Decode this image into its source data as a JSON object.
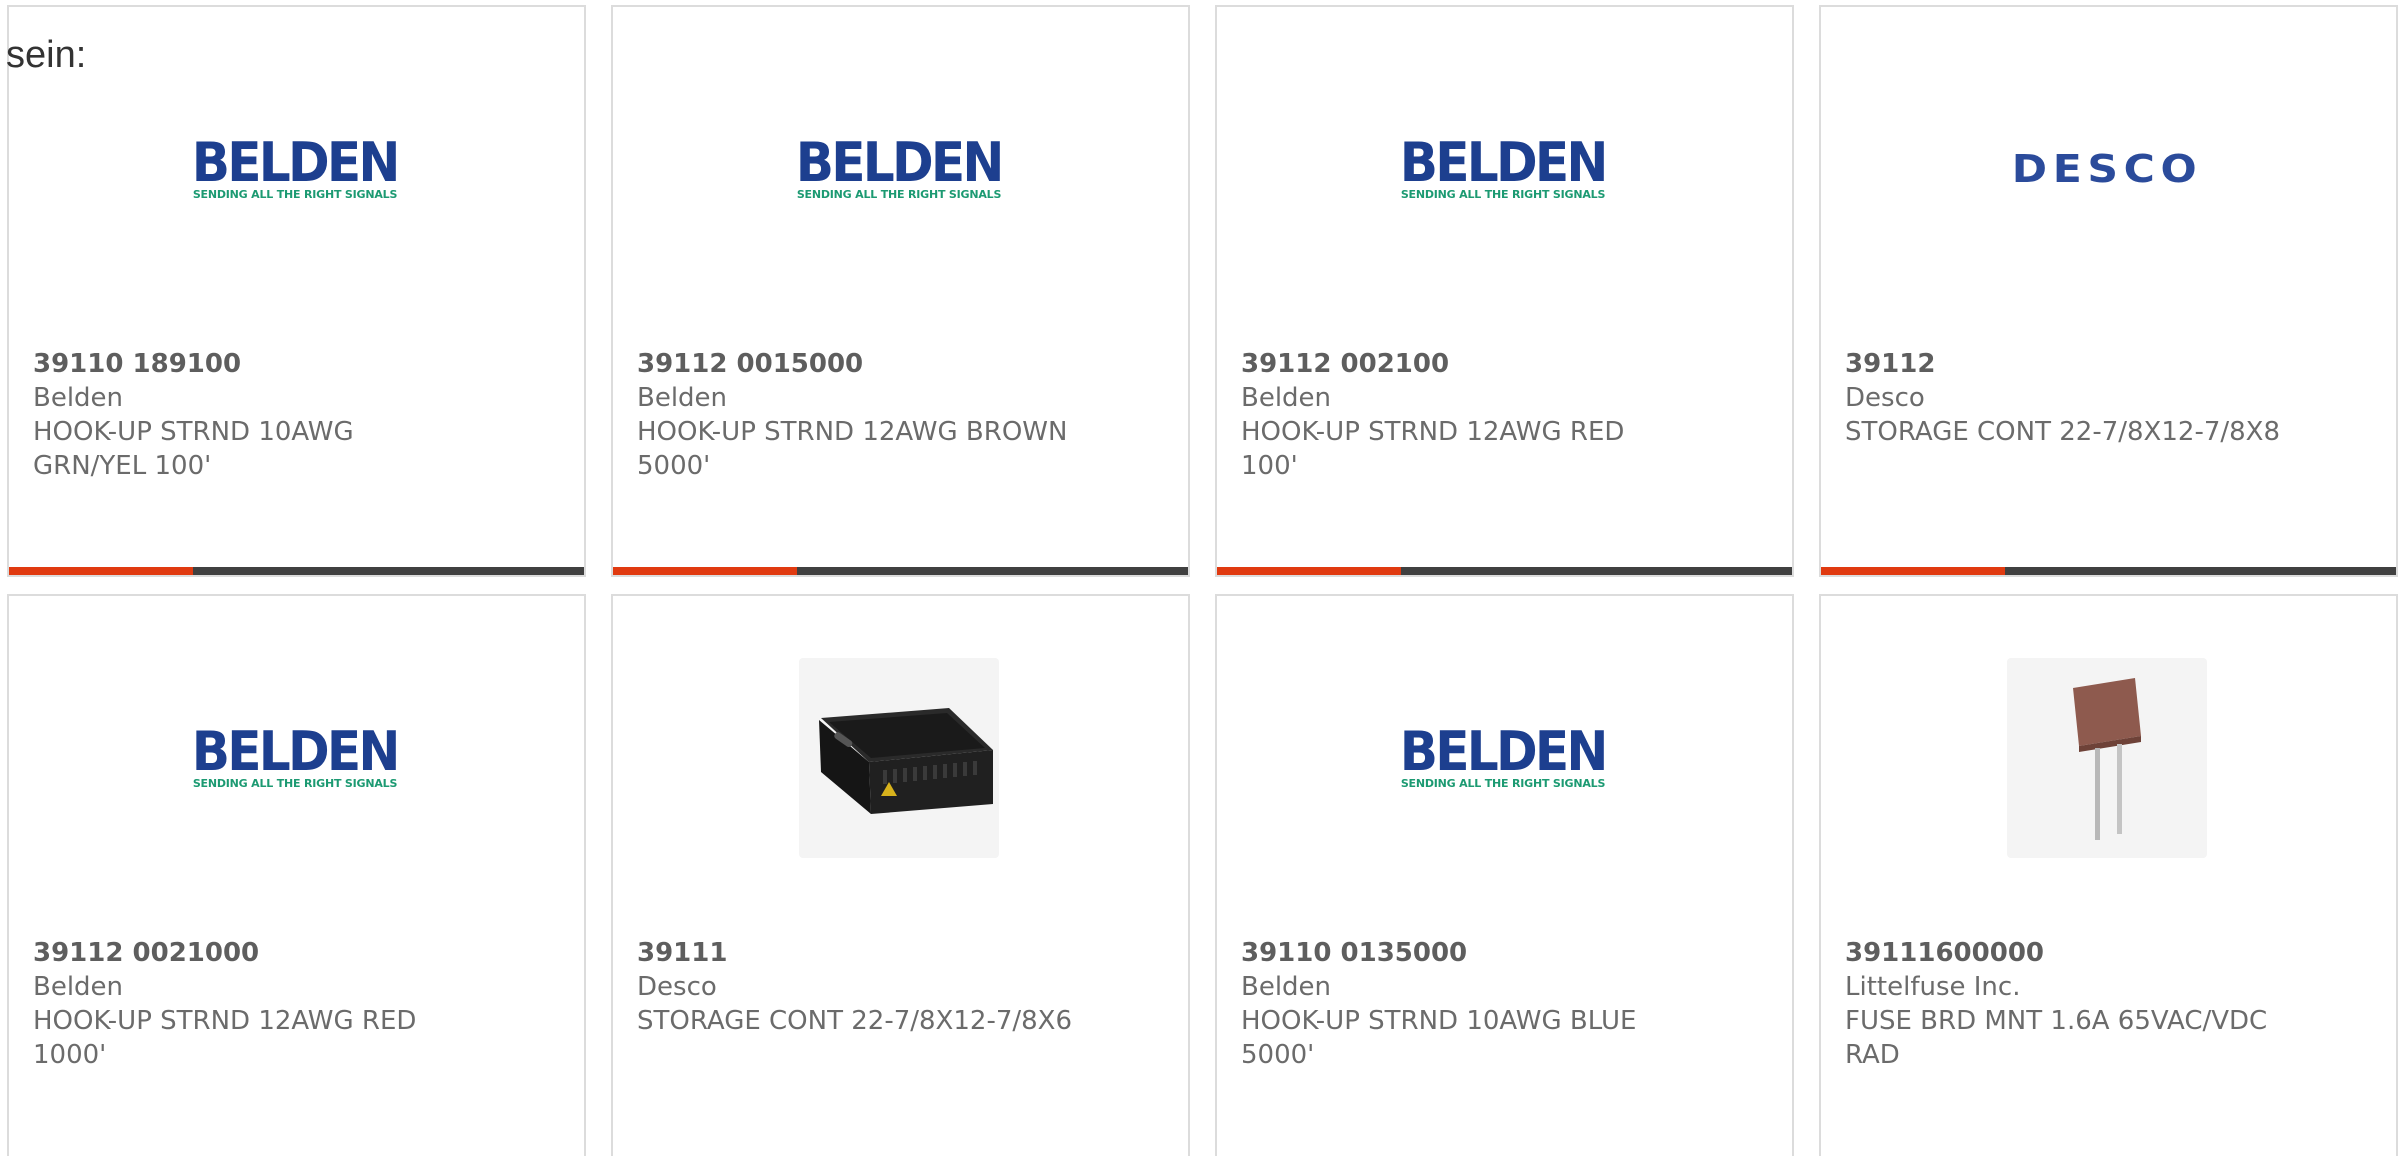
{
  "intro_text": "sein:",
  "colors": {
    "accent": "#e03a10",
    "bar_track": "#404040",
    "belden_blue": "#1d3f8f",
    "belden_green": "#1c9a72",
    "desco_blue": "#2b4b9b"
  },
  "products": [
    {
      "part_number": "39110 189100",
      "manufacturer": "Belden",
      "description_line1": "HOOK-UP STRND 10AWG",
      "description_line2": "GRN/YEL 100'",
      "image": "belden-logo",
      "logo_text": "BELDEN",
      "logo_tagline": "SENDING ALL THE RIGHT SIGNALS"
    },
    {
      "part_number": "39112 0015000",
      "manufacturer": "Belden",
      "description_line1": "HOOK-UP STRND 12AWG BROWN",
      "description_line2": "5000'",
      "image": "belden-logo",
      "logo_text": "BELDEN",
      "logo_tagline": "SENDING ALL THE RIGHT SIGNALS"
    },
    {
      "part_number": "39112 002100",
      "manufacturer": "Belden",
      "description_line1": "HOOK-UP STRND 12AWG RED",
      "description_line2": "100'",
      "image": "belden-logo",
      "logo_text": "BELDEN",
      "logo_tagline": "SENDING ALL THE RIGHT SIGNALS"
    },
    {
      "part_number": "39112",
      "manufacturer": "Desco",
      "description_line1": "STORAGE CONT 22-7/8X12-7/8X8",
      "description_line2": "",
      "image": "desco-logo",
      "logo_text": "DESCO"
    },
    {
      "part_number": "39112 0021000",
      "manufacturer": "Belden",
      "description_line1": "HOOK-UP STRND 12AWG RED",
      "description_line2": "1000'",
      "image": "belden-logo",
      "logo_text": "BELDEN",
      "logo_tagline": "SENDING ALL THE RIGHT SIGNALS"
    },
    {
      "part_number": "39111",
      "manufacturer": "Desco",
      "description_line1": "STORAGE CONT 22-7/8X12-7/8X6",
      "description_line2": "",
      "image": "storage-container-photo"
    },
    {
      "part_number": "39110 0135000",
      "manufacturer": "Belden",
      "description_line1": "HOOK-UP STRND 10AWG BLUE",
      "description_line2": "5000'",
      "image": "belden-logo",
      "logo_text": "BELDEN",
      "logo_tagline": "SENDING ALL THE RIGHT SIGNALS"
    },
    {
      "part_number": "39111600000",
      "manufacturer": "Littelfuse Inc.",
      "description_line1": "FUSE BRD MNT 1.6A 65VAC/VDC",
      "description_line2": "RAD",
      "image": "fuse-photo"
    }
  ],
  "card_progress": 0.32
}
